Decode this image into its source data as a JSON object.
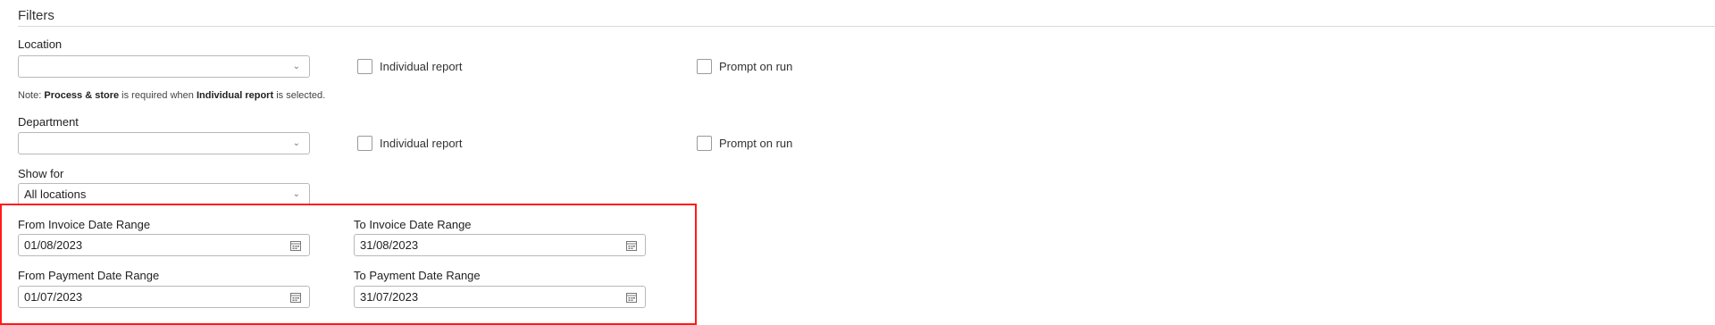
{
  "filters": {
    "title": "Filters",
    "location": {
      "label": "Location",
      "value": "",
      "individual_report_label": "Individual report",
      "prompt_on_run_label": "Prompt on run"
    },
    "note": {
      "prefix": "Note: ",
      "bold1": "Process & store",
      "middle": " is required when ",
      "bold2": "Individual report",
      "suffix": " is selected."
    },
    "department": {
      "label": "Department",
      "value": "",
      "individual_report_label": "Individual report",
      "prompt_on_run_label": "Prompt on run"
    },
    "show_for": {
      "label": "Show for",
      "value": "All locations"
    },
    "date_ranges": {
      "from_invoice": {
        "label": "From Invoice Date Range",
        "value": "01/08/2023"
      },
      "to_invoice": {
        "label": "To Invoice Date Range",
        "value": "31/08/2023"
      },
      "from_payment": {
        "label": "From Payment Date Range",
        "value": "01/07/2023"
      },
      "to_payment": {
        "label": "To Payment Date Range",
        "value": "31/07/2023"
      }
    }
  },
  "icons": {
    "chevron": "chevron-down-icon",
    "calendar": "calendar-icon"
  },
  "colors": {
    "highlight_border": "#ff1a1a"
  }
}
